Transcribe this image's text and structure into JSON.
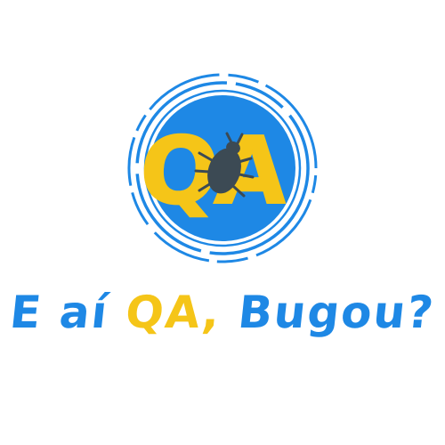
{
  "logo": {
    "letters": "QA",
    "icon": "bug-icon",
    "colors": {
      "ring_blue": "#1e88e5",
      "inner_blue": "#1e88e5",
      "letter_yellow": "#f5c518",
      "bug_gray": "#3c4a54",
      "background": "#ffffff"
    }
  },
  "tagline": {
    "part1": "E aí ",
    "part2": "QA,",
    "part3": " Bugou?",
    "color_blue": "#1e88e5",
    "color_yellow": "#f5c518"
  }
}
